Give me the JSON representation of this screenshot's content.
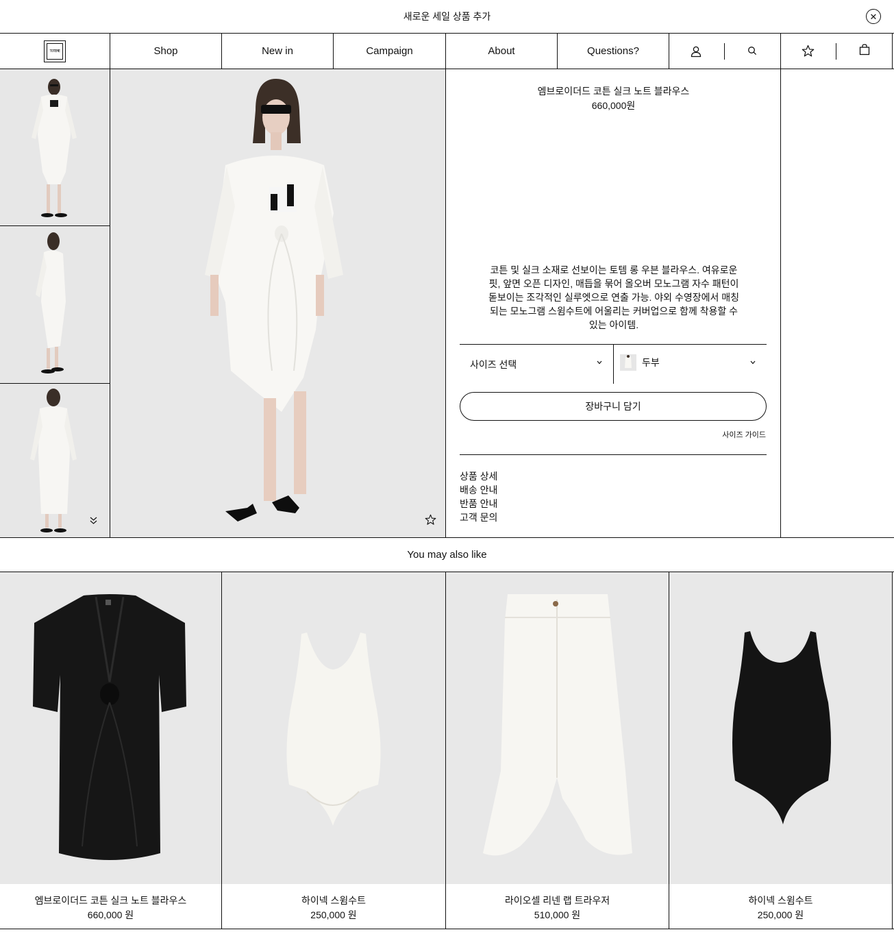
{
  "announcement": {
    "text": "새로운 세일 상품 추가",
    "close_icon": "close-icon"
  },
  "nav": {
    "logo_text": "TOTEME",
    "items": [
      "Shop",
      "New in",
      "Campaign",
      "About",
      "Questions?"
    ],
    "icons": [
      "account-icon",
      "search-icon",
      "wishlist-star-icon",
      "bag-icon"
    ]
  },
  "product": {
    "title": "엠브로이더드 코튼 실크 노트 블라우스",
    "price": "660,000원",
    "description": "코튼 및 실크 소재로 선보이는 토템 롱 우븐 블라우스. 여유로운 핏, 앞면 오픈 디자인, 매듭을 묶어 올오버 모노그램 자수 패턴이 돋보이는 조각적인 실루엣으로 연출 가능. 야외 수영장에서 매칭되는 모노그램 스윔수트에 어울리는 커버업으로 함께 착용할 수 있는 아이템.",
    "size_select": "사이즈 선택",
    "color_select": "두부",
    "add_to_cart": "장바구니 담기",
    "size_guide": "사이즈 가이드",
    "links": [
      "상품 상세",
      "배송 안내",
      "반품 안내",
      "고객 문의"
    ]
  },
  "recommendations": {
    "heading": "You may also like",
    "items": [
      {
        "name": "엠브로이더드 코튼 실크 노트 블라우스",
        "price": "660,000 원"
      },
      {
        "name": "하이넥 스윔수트",
        "price": "250,000 원"
      },
      {
        "name": "라이오셀 리넨 랩 트라우저",
        "price": "510,000 원"
      },
      {
        "name": "하이넥 스윔수트",
        "price": "250,000 원"
      }
    ]
  },
  "colors": {
    "ink": "#111111",
    "image_bg": "#e8e8e8",
    "garment_white": "#f6f5f2",
    "garment_black": "#161616"
  }
}
